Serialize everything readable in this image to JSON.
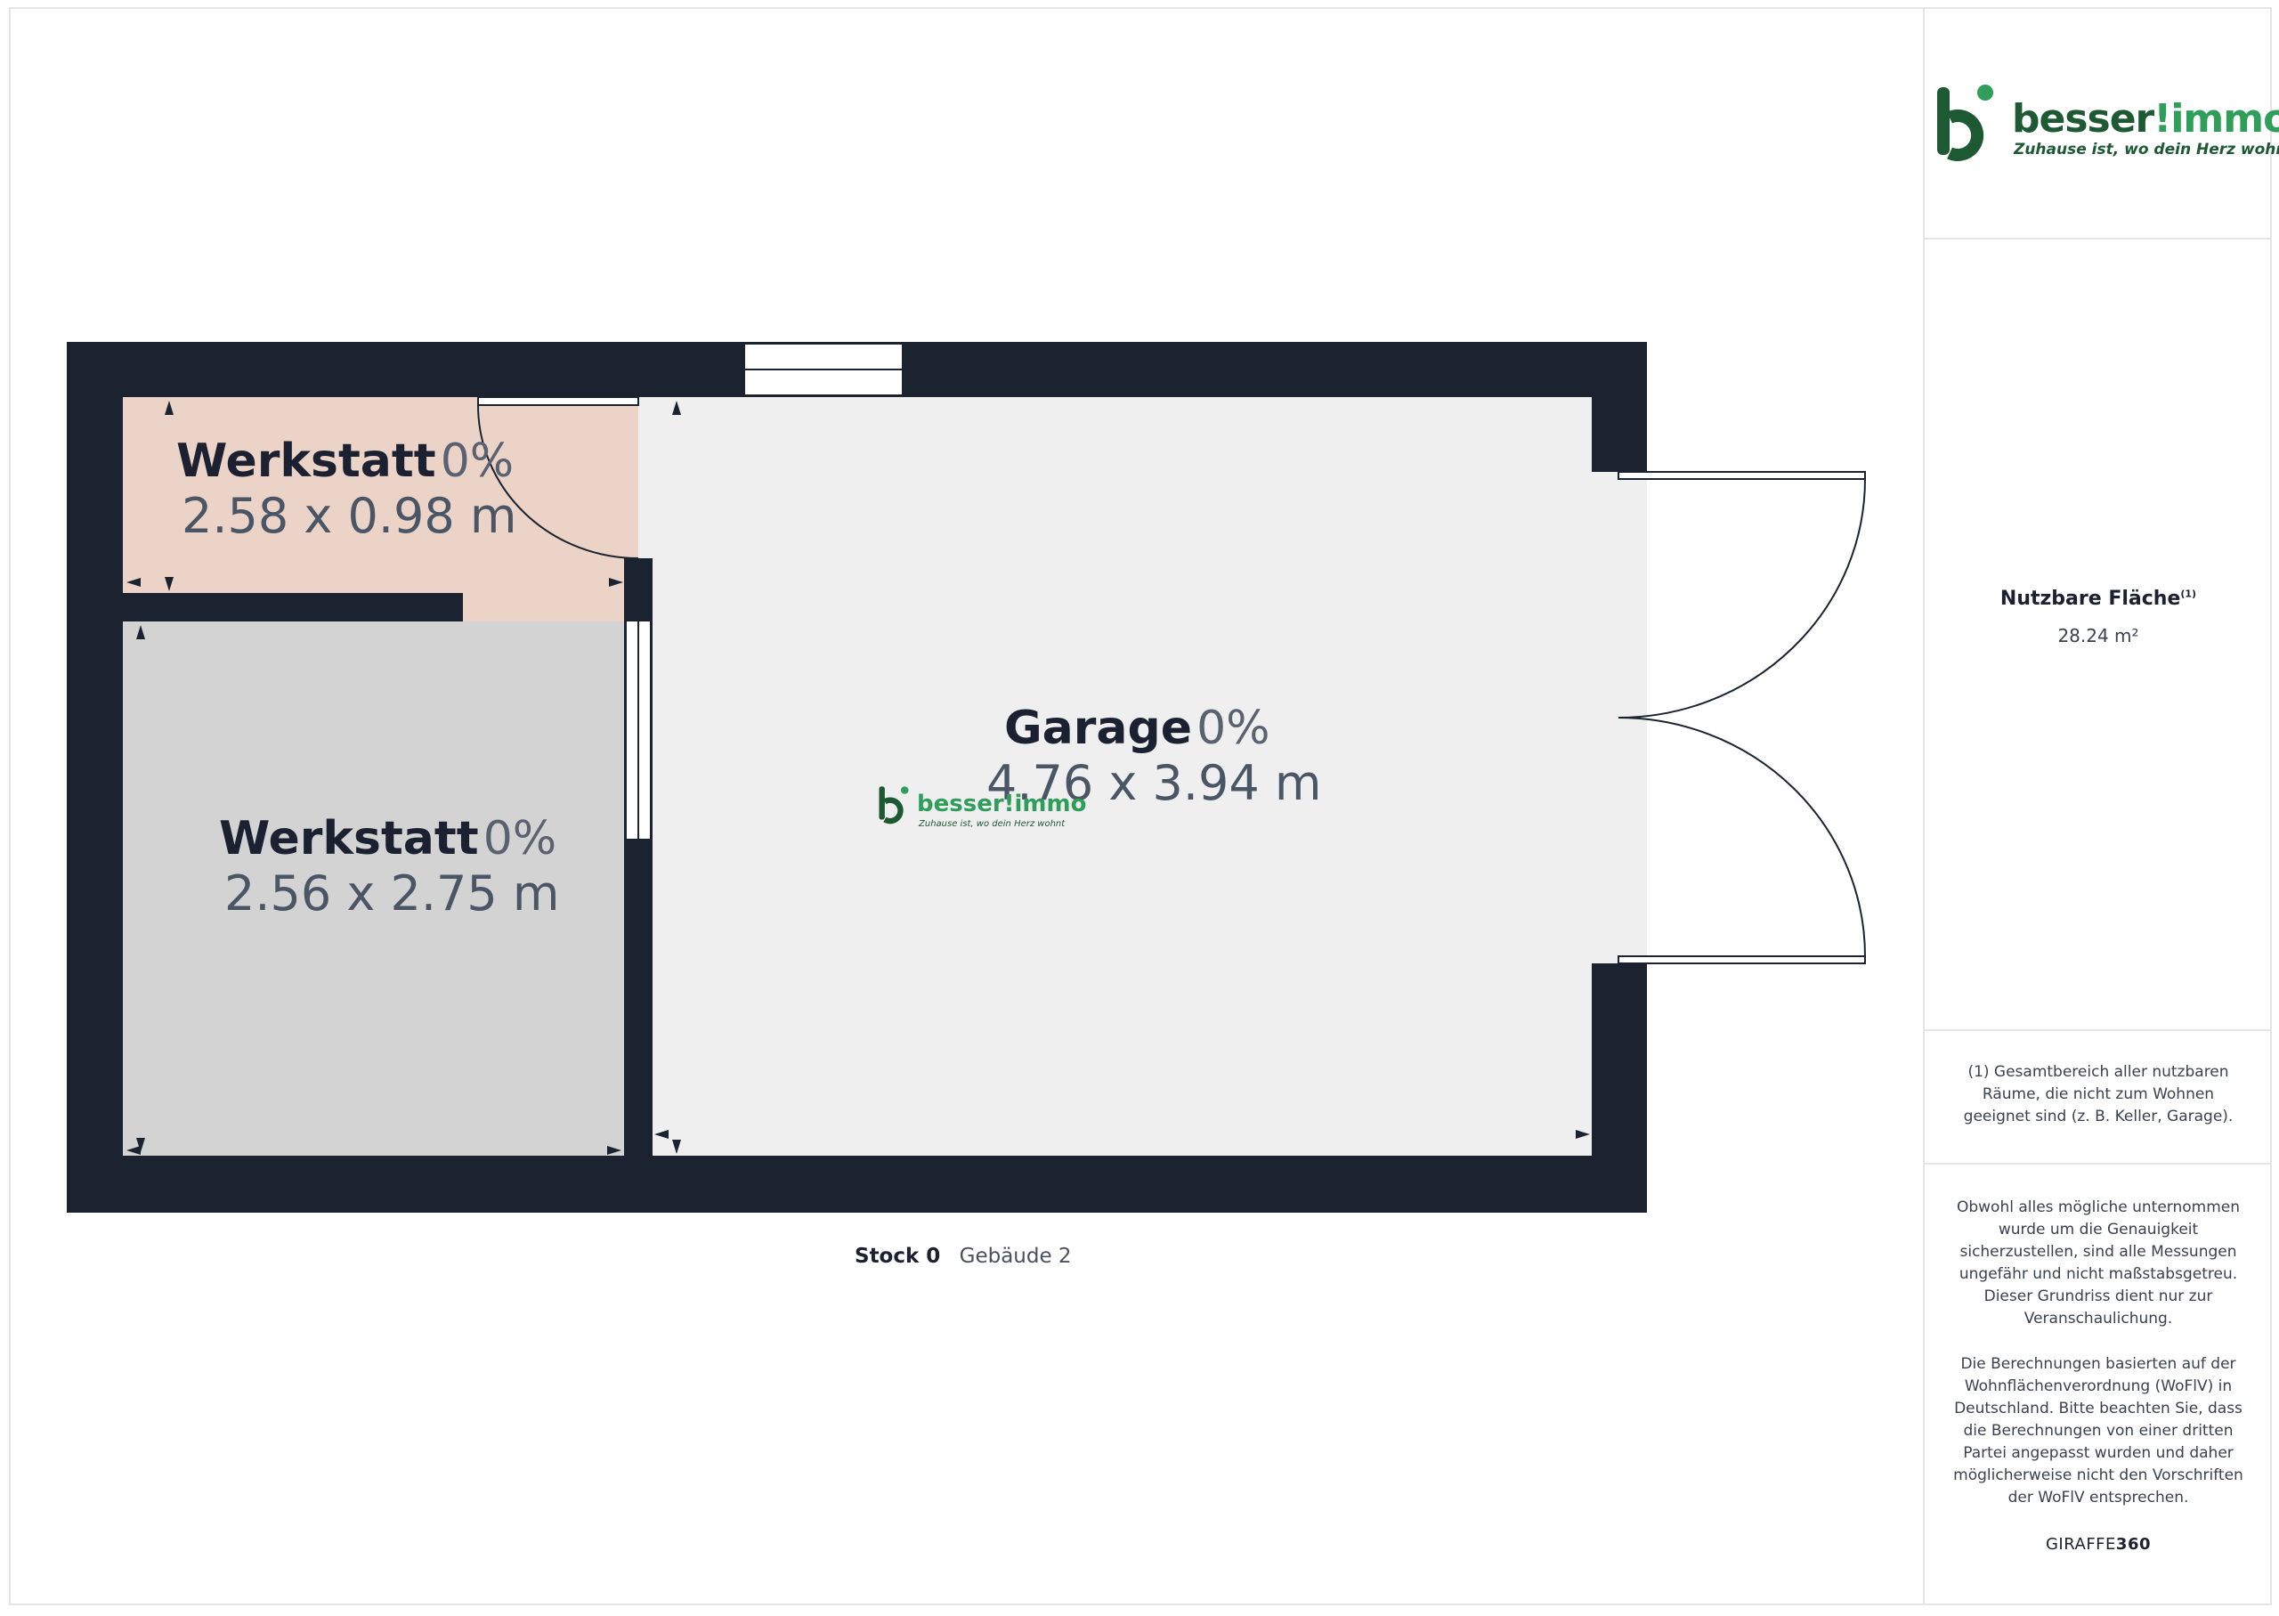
{
  "branding": {
    "logo_word_part1": "besser",
    "logo_word_part2": "!immo",
    "tagline": "Zuhause ist, wo dein Herz wohnt",
    "colors": {
      "green": "#2f9e5a",
      "dark_green": "#1d5a33"
    }
  },
  "rooms": [
    {
      "name": "Werkstatt",
      "percent": "0%",
      "dimensions": "2.58 x 0.98 m",
      "fill": "#ecd3c8"
    },
    {
      "name": "Werkstatt",
      "percent": "0%",
      "dimensions": "2.56 x 2.75 m",
      "fill": "#d3d3d3"
    },
    {
      "name": "Garage",
      "percent": "0%",
      "dimensions": "4.76 x 3.94 m",
      "fill": "#efefef"
    }
  ],
  "caption": {
    "floor": "Stock 0",
    "building": "Gebäude 2"
  },
  "sidebar": {
    "area_label": "Nutzbare Fläche",
    "area_footnote": "(1)",
    "area_value": "28.24 m²",
    "footnote_text": "(1) Gesamtbereich aller nutzbaren Räume, die nicht zum Wohnen geeignet sind (z. B. Keller, Garage).",
    "disclaimer_1": "Obwohl alles mögliche unternommen wurde um die Genauigkeit sicherzustellen, sind alle Messungen ungefähr und nicht maßstabsgetreu. Dieser Grundriss dient nur zur Veranschaulichung.",
    "disclaimer_2": "Die Berechnungen basierten auf der Wohnflächenverordnung (WoFlV) in Deutschland. Bitte beachten Sie, dass die Berechnungen von einer dritten Partei angepasst wurden und daher möglicherweise nicht den Vorschriften der WoFlV entsprechen.",
    "brand_part1": "GIRAFFE",
    "brand_part2": "360"
  },
  "colors": {
    "wall": "#1b2330",
    "border": "#e3e5e8"
  }
}
